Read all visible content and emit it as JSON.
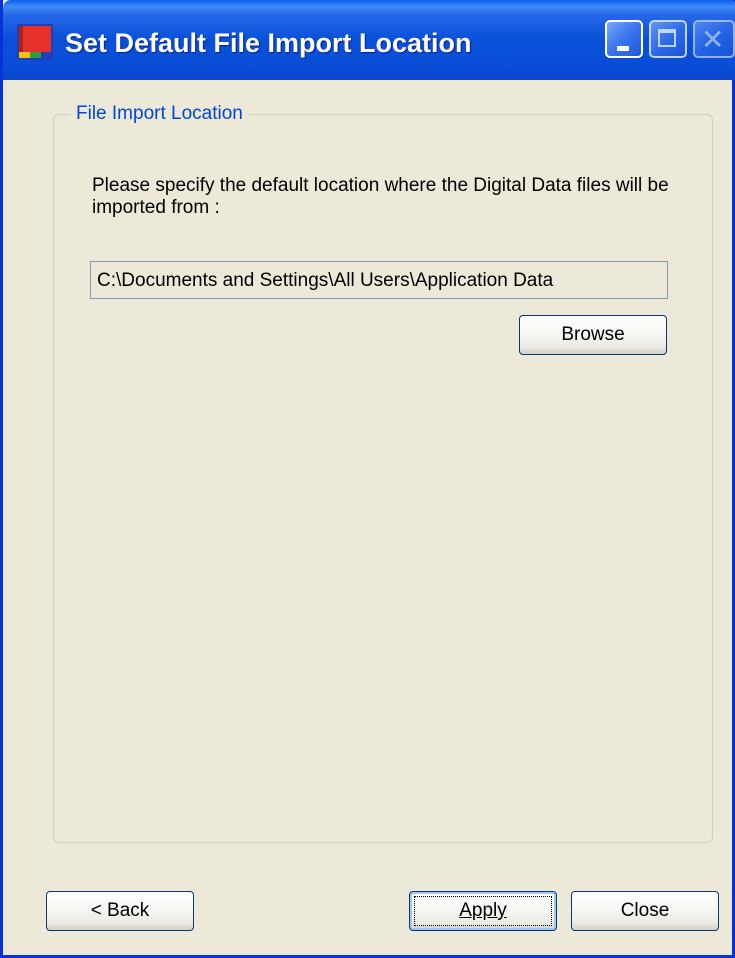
{
  "window": {
    "title": "Set Default File Import Location"
  },
  "titlebar_buttons": {
    "minimize_icon": "minimize-icon",
    "maximize_icon": "maximize-icon",
    "close_icon": "close-icon"
  },
  "group": {
    "label": "File Import Location",
    "description": "Please specify the default location where the Digital Data files will be imported from :",
    "path_value": "C:\\Documents and Settings\\All Users\\Application Data",
    "browse_label": "Browse"
  },
  "footer": {
    "back_label": "< Back",
    "apply_label": "Apply",
    "close_label": "Close"
  },
  "colors": {
    "titlebar": "#0A4ED8",
    "window_bg": "#ECE9D8",
    "group_label": "#0046D5"
  }
}
